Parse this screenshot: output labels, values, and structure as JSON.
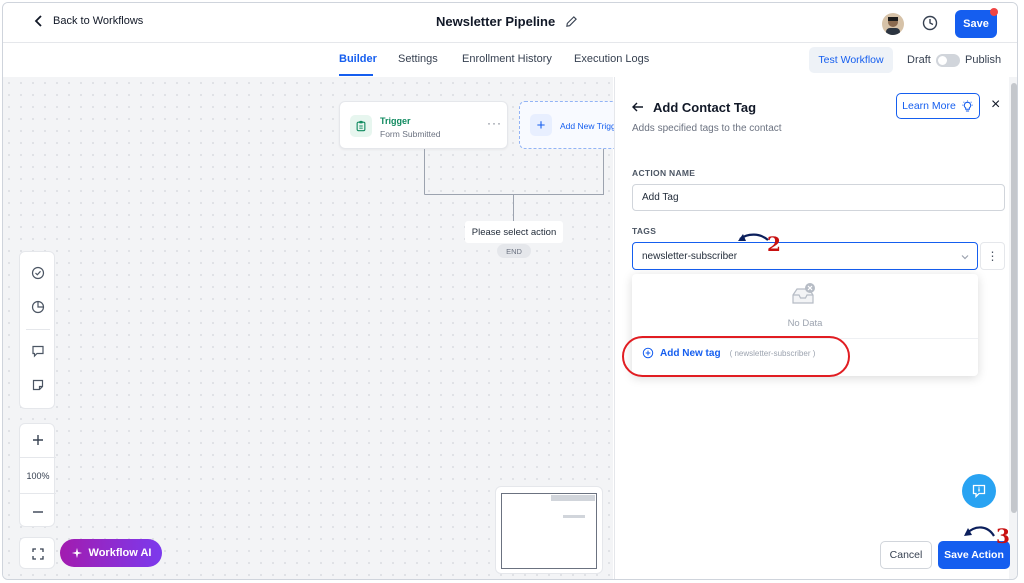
{
  "header": {
    "back_label": "Back to Workflows",
    "title": "Newsletter Pipeline",
    "save_label": "Save"
  },
  "tabs": [
    {
      "label": "Builder",
      "active": true
    },
    {
      "label": "Settings",
      "active": false
    },
    {
      "label": "Enrollment History",
      "active": false
    },
    {
      "label": "Execution Logs",
      "active": false
    }
  ],
  "toolbar_right": {
    "test_workflow": "Test Workflow",
    "draft": "Draft",
    "publish": "Publish"
  },
  "canvas": {
    "trigger": {
      "label": "Trigger",
      "subtitle": "Form Submitted"
    },
    "add_trigger_label": "Add New Trigger",
    "select_action": "Please select action",
    "end_label": "END",
    "zoom": "100%",
    "workflow_ai": "Workflow AI"
  },
  "panel": {
    "title": "Add Contact Tag",
    "description": "Adds specified tags to the contact",
    "learn_more": "Learn More",
    "action_name_label": "ACTION NAME",
    "action_name_value": "Add Tag",
    "tags_label": "TAGS",
    "tags_value": "newsletter-subscriber",
    "no_data": "No Data",
    "add_new_tag": "Add New tag",
    "add_new_tag_hint": "( newsletter-subscriber )",
    "cancel": "Cancel",
    "save_action": "Save Action"
  },
  "annotations": [
    "2",
    "3"
  ],
  "colors": {
    "accent": "#155eef",
    "trigger_green": "#0f8a5f",
    "annotation_red": "#e11d22",
    "ai_gradient_start": "#a21caf",
    "ai_gradient_end": "#7c3aed"
  }
}
